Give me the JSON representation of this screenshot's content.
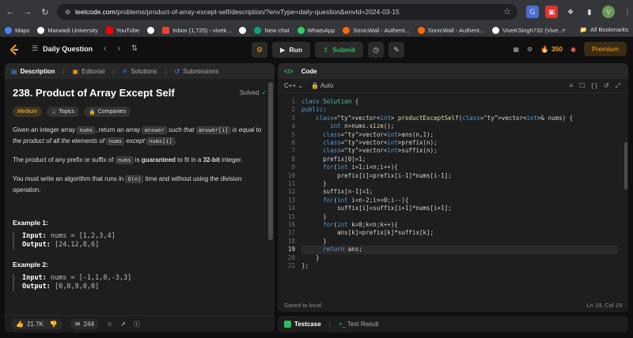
{
  "browser": {
    "url_host": "leetcode.com",
    "url_rest": "/problems/product-of-array-except-self/description/?envType=daily-question&envId=2024-03-15",
    "bookmarks": [
      {
        "label": "Maps",
        "color": "#4285f4"
      },
      {
        "label": "Marwadi University",
        "color": "#ffffff"
      },
      {
        "label": "YouTube",
        "color": "#ff0000"
      },
      {
        "label": "",
        "color": "#ffffff"
      },
      {
        "label": "Inbox (1,725) - vivek...",
        "color": "#ea4335"
      },
      {
        "label": "",
        "color": "#ffffff"
      },
      {
        "label": "New chat",
        "color": "#10a37f"
      },
      {
        "label": "WhatsApp",
        "color": "#25d366"
      },
      {
        "label": "SonicWall - Authent...",
        "color": "#ff6a00"
      },
      {
        "label": "SonicWall - Authent...",
        "color": "#ff6a00"
      },
      {
        "label": "ViveKSingh732 (Vive...",
        "color": "#ffffff"
      }
    ],
    "more": "»",
    "all_bookmarks": "All Bookmarks"
  },
  "topbar": {
    "daily_label": "Daily Question",
    "run_label": "Run",
    "submit_label": "Submit",
    "streak": "350",
    "premium_label": "Premium"
  },
  "description": {
    "tabs": [
      "Description",
      "Editorial",
      "Solutions",
      "Submissions"
    ],
    "title": "238. Product of Array Except Self",
    "solved_label": "Solved",
    "chips": [
      "Medium",
      "Topics",
      "Companies"
    ],
    "p1_a": "Given an integer array ",
    "p1_code1": "nums",
    "p1_b": ", return an array ",
    "p1_code2": "answer",
    "p1_c": " such that ",
    "p1_code3": "answer[i]",
    "p1_d": " is equal to the product of all the elements of ",
    "p1_code4": "nums",
    "p1_e": " except ",
    "p1_code5": "nums[i]",
    "p1_f": ".",
    "p2_a": "The product of any prefix or suffix of ",
    "p2_code": "nums",
    "p2_b": " is ",
    "p2_bold1": "guaranteed",
    "p2_c": " to fit in a ",
    "p2_bold2": "32-bit",
    "p2_d": " integer.",
    "p3_a": "You must write an algorithm that runs in ",
    "p3_code": "O(n)",
    "p3_b": " time and without using the division operation.",
    "examples": [
      {
        "title": "Example 1:",
        "input": "nums = [1,2,3,4]",
        "output": "[24,12,8,6]"
      },
      {
        "title": "Example 2:",
        "input": "nums = [-1,1,0,-3,3]",
        "output": "[0,0,9,0,0]"
      }
    ],
    "input_label": "Input:",
    "output_label": "Output:",
    "likes": "21.7K",
    "comments": "244"
  },
  "editor": {
    "header": "Code",
    "language": "C++",
    "mode": "Auto",
    "saved": "Saved to local",
    "cursor": "Ln 19, Col 19",
    "current_line": 19,
    "lines": [
      "class Solution {",
      "public:",
      "    vector<int> productExceptSelf(vector<int>& nums) {",
      "        int n=nums.size();",
      "      vector<int>ans(n,1);",
      "      vector<int>prefix(n);",
      "      vector<int>suffix(n);",
      "      prefix[0]=1;",
      "      for(int i=1;i<n;i++){",
      "          prefix[i]=prefix[i-1]*nums[i-1];",
      "      }",
      "      suffix[n-1]=1;",
      "      for(int i=n-2;i>=0;i--){",
      "          suffix[i]=suffix[i+1]*nums[i+1];",
      "      }",
      "      for(int k=0;k<n;k++){",
      "          ans[k]=prefix[k]*suffix[k];",
      "      }",
      "      return ans;",
      "    }",
      "};"
    ]
  },
  "testpanel": {
    "testcase_label": "Testcase",
    "result_label": "Test Result"
  }
}
